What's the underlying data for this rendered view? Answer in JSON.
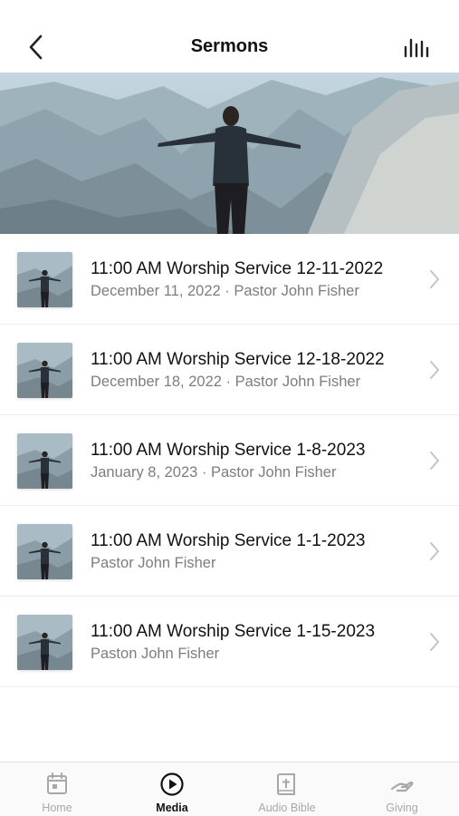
{
  "header": {
    "title": "Sermons",
    "back_icon": "chevron-left-icon",
    "audio_icon": "audio-bars-icon"
  },
  "sermons": [
    {
      "title": "11:00 AM Worship Service 12-11-2022",
      "subtitle": "December 11, 2022 · Pastor John Fisher"
    },
    {
      "title": "11:00 AM Worship Service 12-18-2022",
      "subtitle": "December 18, 2022 · Pastor John Fisher"
    },
    {
      "title": "11:00 AM Worship Service 1-8-2023",
      "subtitle": "January 8, 2023 · Pastor John Fisher"
    },
    {
      "title": "11:00 AM Worship Service 1-1-2023",
      "subtitle": "Pastor John Fisher"
    },
    {
      "title": "11:00 AM Worship Service 1-15-2023",
      "subtitle": "Paston John Fisher"
    }
  ],
  "tabs": [
    {
      "label": "Home",
      "icon": "calendar-icon",
      "active": false
    },
    {
      "label": "Media",
      "icon": "play-circle-icon",
      "active": true
    },
    {
      "label": "Audio Bible",
      "icon": "bible-icon",
      "active": false
    },
    {
      "label": "Giving",
      "icon": "giving-hand-icon",
      "active": false
    }
  ],
  "colors": {
    "active_tab": "#111111",
    "inactive_tab": "#a8a8a8",
    "subtitle": "#7d7d7d"
  }
}
